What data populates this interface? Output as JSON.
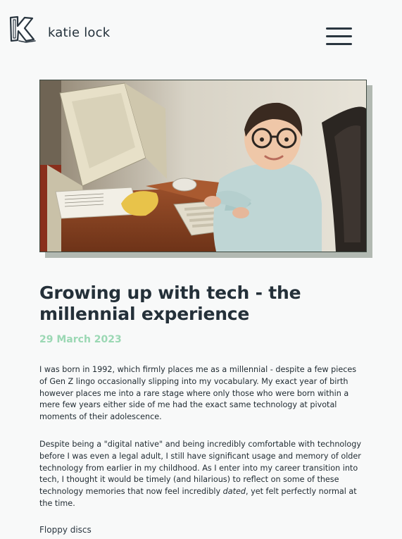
{
  "header": {
    "brand_name": "katie lock",
    "logo_icon": "k-letter-logo-icon",
    "menu_icon": "hamburger-menu-icon"
  },
  "hero_image": {
    "alt": "Toddler with glasses typing on an old beige computer keyboard"
  },
  "article": {
    "title": "Growing up with tech - the millennial experience",
    "date": "29 March 2023",
    "paragraph1": "I was born in 1992, which firmly places me as a millennial - despite a few pieces of Gen Z lingo occasionally slipping into my vocabulary. My exact year of birth however places me into a rare stage where only those who were born within a mere few years either side of me had the exact same technology at pivotal moments of their adolescence.",
    "paragraph2_before": "Despite being a \"digital native\" and being incredibly comfortable with technology before I was even a legal adult, I still have significant usage and memory of older technology from earlier in my childhood. As I enter into my career transition into tech, I thought it would be timely (and hilarious) to reflect on some of these technology memories that now feel incredibly ",
    "paragraph2_emphasis": "dated",
    "paragraph2_after": ", yet felt perfectly normal at the time.",
    "subheading": "Floppy discs"
  },
  "colors": {
    "background": "#f8f9f9",
    "accent_date": "#9bd8b4",
    "text": "#1f2a31"
  }
}
